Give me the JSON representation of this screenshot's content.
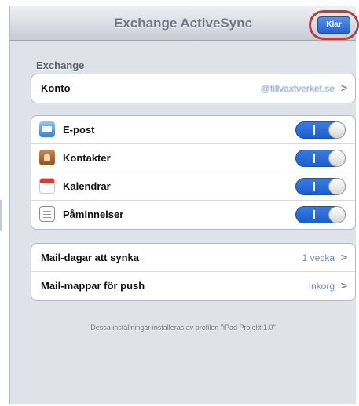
{
  "navbar": {
    "title": "Exchange ActiveSync",
    "done_label": "Klar"
  },
  "account_section": {
    "header": "Exchange",
    "row": {
      "label": "Konto",
      "value": "@tillvaxtverket.se",
      "chevron": ">"
    }
  },
  "sync_items": [
    {
      "label": "E-post",
      "icon": "mail-icon",
      "enabled": true
    },
    {
      "label": "Kontakter",
      "icon": "contacts-icon",
      "enabled": true
    },
    {
      "label": "Kalendrar",
      "icon": "calendar-icon",
      "enabled": true
    },
    {
      "label": "Påminnelser",
      "icon": "reminders-icon",
      "enabled": true
    }
  ],
  "mail_settings": [
    {
      "label": "Mail-dagar att synka",
      "value": "1 vecka",
      "chevron": ">"
    },
    {
      "label": "Mail-mappar för push",
      "value": "Inkorg",
      "chevron": ">"
    }
  ],
  "footer_note": "Dessa inställningar installeras av profilen \"iPad Projekt 1.0\"",
  "colors": {
    "accent": "#2164d4",
    "highlight_circle": "#b4413e",
    "background": "#dfe2e8"
  }
}
